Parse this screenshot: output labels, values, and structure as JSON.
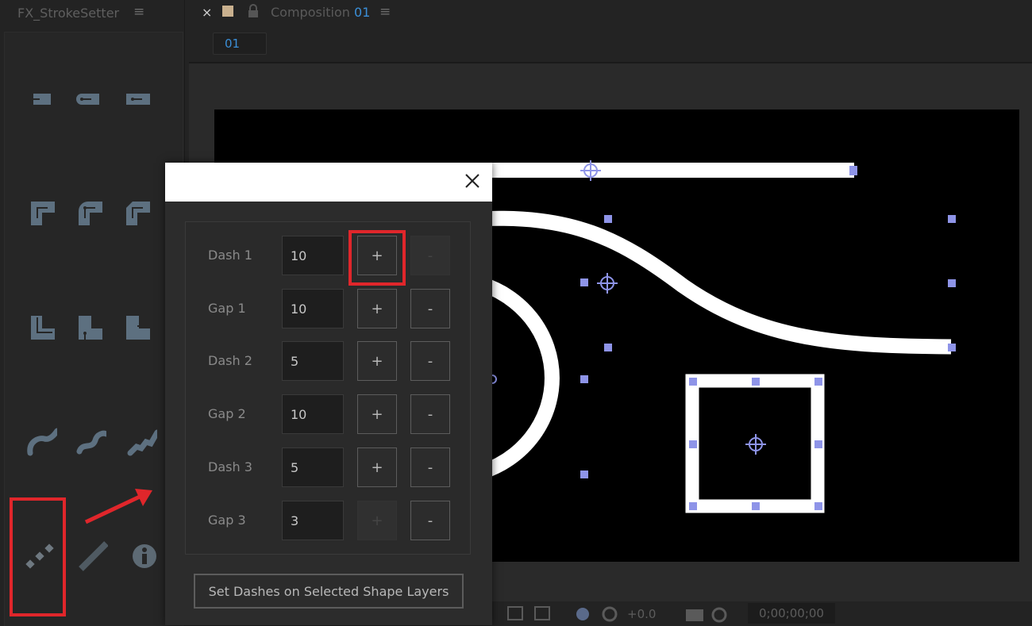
{
  "left_panel": {
    "title": "FX_StrokeSetter",
    "menu_icon": "hamburger-icon",
    "tools": [
      "cap-butt-icon",
      "cap-round-icon",
      "cap-square-icon",
      "join-miter-icon",
      "join-round-icon",
      "join-bevel-icon",
      "corner-a-icon",
      "corner-b-icon",
      "corner-c-icon",
      "taper-a-icon",
      "taper-b-icon",
      "wiggle-icon",
      "dashes-icon",
      "solid-line-icon",
      "info-icon"
    ]
  },
  "composition": {
    "close": "×",
    "title": "Composition",
    "name": "01",
    "tab": "01",
    "zoom_readout": "+0.0",
    "timecode": "0;00;00;00"
  },
  "dialog": {
    "close_icon": "close-icon",
    "rows": [
      {
        "label": "Dash 1",
        "value": "10",
        "plus": "+",
        "minus": "-",
        "plus_enabled": true,
        "minus_enabled": false
      },
      {
        "label": "Gap 1",
        "value": "10",
        "plus": "+",
        "minus": "-",
        "plus_enabled": true,
        "minus_enabled": true
      },
      {
        "label": "Dash 2",
        "value": "5",
        "plus": "+",
        "minus": "-",
        "plus_enabled": true,
        "minus_enabled": true
      },
      {
        "label": "Gap 2",
        "value": "10",
        "plus": "+",
        "minus": "-",
        "plus_enabled": true,
        "minus_enabled": true
      },
      {
        "label": "Dash 3",
        "value": "5",
        "plus": "+",
        "minus": "-",
        "plus_enabled": true,
        "minus_enabled": true
      },
      {
        "label": "Gap 3",
        "value": "3",
        "plus": "+",
        "minus": "-",
        "plus_enabled": false,
        "minus_enabled": true
      }
    ],
    "action_label": "Set Dashes on Selected Shape Layers"
  },
  "colors": {
    "highlight": "#e0262b",
    "handle": "#8e94e8",
    "accent_blue": "#3b8fd8"
  }
}
